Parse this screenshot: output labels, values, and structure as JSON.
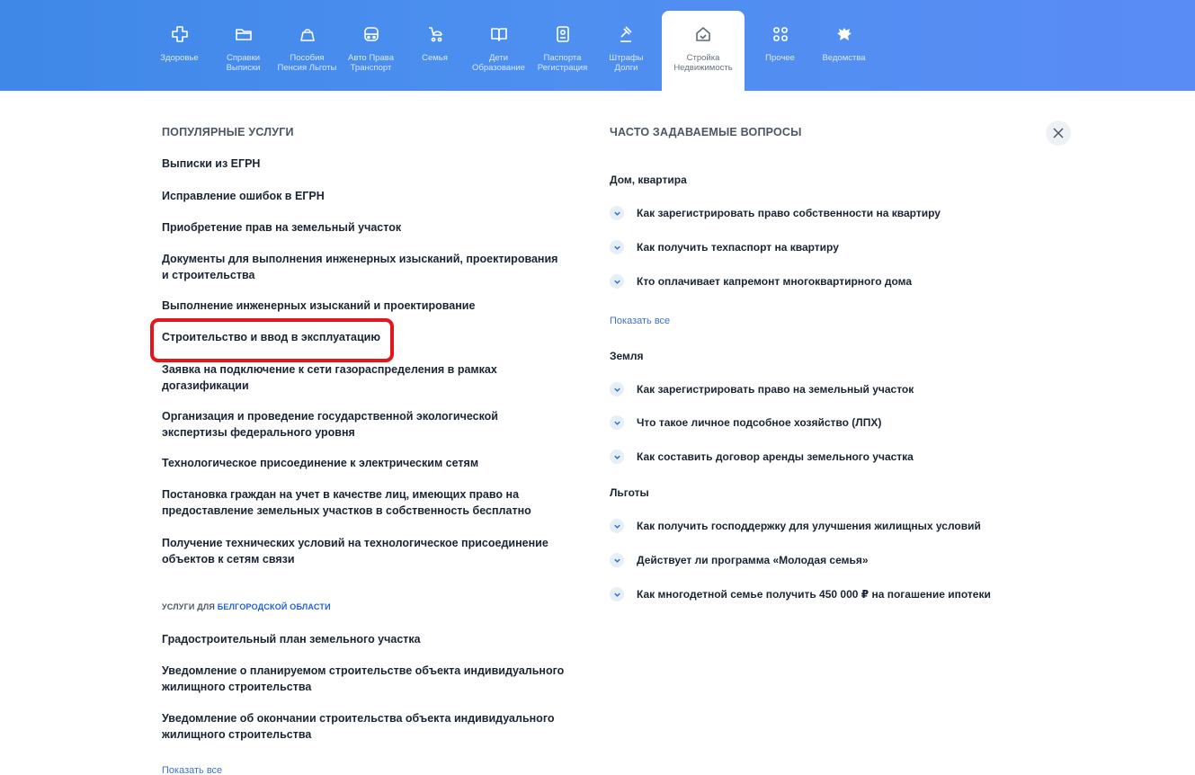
{
  "nav": {
    "categories": [
      {
        "icon": "plus-cross-icon",
        "label": "Здоровье"
      },
      {
        "icon": "folder-icon",
        "label": "Справки\nВыписки"
      },
      {
        "icon": "wallet-icon",
        "label": "Пособия\nПенсия Льготы"
      },
      {
        "icon": "car-icon",
        "label": "Авто Права\nТранспорт"
      },
      {
        "icon": "stroller-icon",
        "label": "Семья"
      },
      {
        "icon": "book-icon",
        "label": "Дети\nОбразование"
      },
      {
        "icon": "passport-icon",
        "label": "Паспорта\nРегистрация"
      },
      {
        "icon": "gavel-icon",
        "label": "Штрафы\nДолги"
      },
      {
        "icon": "house-icon",
        "label": "Стройка\nНедвижимость",
        "active": true
      },
      {
        "icon": "grid-icon",
        "label": "Прочее"
      },
      {
        "icon": "eagle-emblem-icon",
        "label": "Ведомства"
      }
    ]
  },
  "popular": {
    "title": "ПОПУЛЯРНЫЕ УСЛУГИ",
    "items": [
      "Выписки из ЕГРН",
      "Исправление ошибок в ЕГРН",
      "Приобретение прав на земельный участок",
      "Документы для выполнения инженерных изысканий, проектирования и строительства",
      "Выполнение инженерных изысканий и проектирование",
      "Строительство и ввод в эксплуатацию",
      "Заявка на подключение к сети газораспределения в рамках догазификации",
      "Организация и проведение государственной экологической экспертизы федерального уровня",
      "Технологическое присоединение к электрическим сетям",
      "Постановка граждан на учет в качестве лиц, имеющих право на предоставление земельных участков в собственность бесплатно",
      "Получение технических условий на технологическое присоединение объектов к сетям связи"
    ],
    "highlighted_item": "Строительство и ввод в эксплуатацию"
  },
  "regional": {
    "title_prefix": "УСЛУГИ ДЛЯ",
    "region_link": "БЕЛГОРОДСКОЙ ОБЛАСТИ",
    "items": [
      "Градостроительный план земельного участка",
      "Уведомление о планируемом строительстве объекта индивидуального жилищного строительства",
      "Уведомление об окончании строительства объекта индивидуального жилищного строительства"
    ],
    "show_all": "Показать все"
  },
  "faq": {
    "title": "ЧАСТО ЗАДАВАЕМЫЕ ВОПРОСЫ",
    "groups": [
      {
        "title": "Дом, квартира",
        "questions": [
          "Как зарегистрировать право собственности на квартиру",
          "Как получить техпаспорт на квартиру",
          "Кто оплачивает капремонт многоквартирного дома"
        ],
        "show_all": "Показать все"
      },
      {
        "title": "Земля",
        "questions": [
          "Как зарегистрировать право на земельный участок",
          "Что такое личное подсобное хозяйство (ЛПХ)",
          "Как составить договор аренды земельного участка"
        ]
      },
      {
        "title": "Льготы",
        "questions": [
          "Как получить господдержку для улучшения жилищных условий",
          "Действует ли программа «Молодая семья»",
          "Как многодетной семье получить 450 000 ₽ на погашение ипотеки"
        ]
      }
    ]
  },
  "colors": {
    "nav_gradient_start": "#3f88e8",
    "nav_gradient_end": "#5a8cf5",
    "link": "#3f72c7",
    "highlight_box": "#e3171a"
  }
}
